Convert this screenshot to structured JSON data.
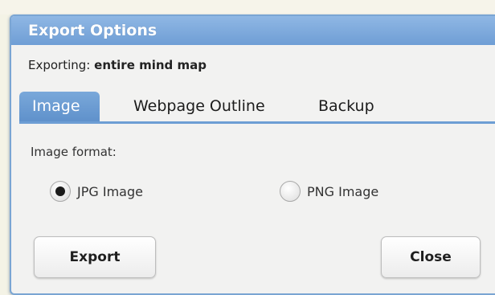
{
  "dialog": {
    "title": "Export Options",
    "exporting_label": "Exporting:",
    "exporting_value": "entire mind map"
  },
  "tabs": [
    {
      "label": "Image",
      "active": true
    },
    {
      "label": "Webpage Outline",
      "active": false
    },
    {
      "label": "Backup",
      "active": false
    }
  ],
  "image_format": {
    "label": "Image format:",
    "options": [
      {
        "label": "JPG Image",
        "selected": true
      },
      {
        "label": "PNG Image",
        "selected": false
      }
    ]
  },
  "buttons": {
    "export": "Export",
    "close": "Close"
  },
  "colors": {
    "title_bar": "#7aa8da",
    "tab_active": "#6d9ed4",
    "dialog_bg": "#f2f2f1"
  }
}
